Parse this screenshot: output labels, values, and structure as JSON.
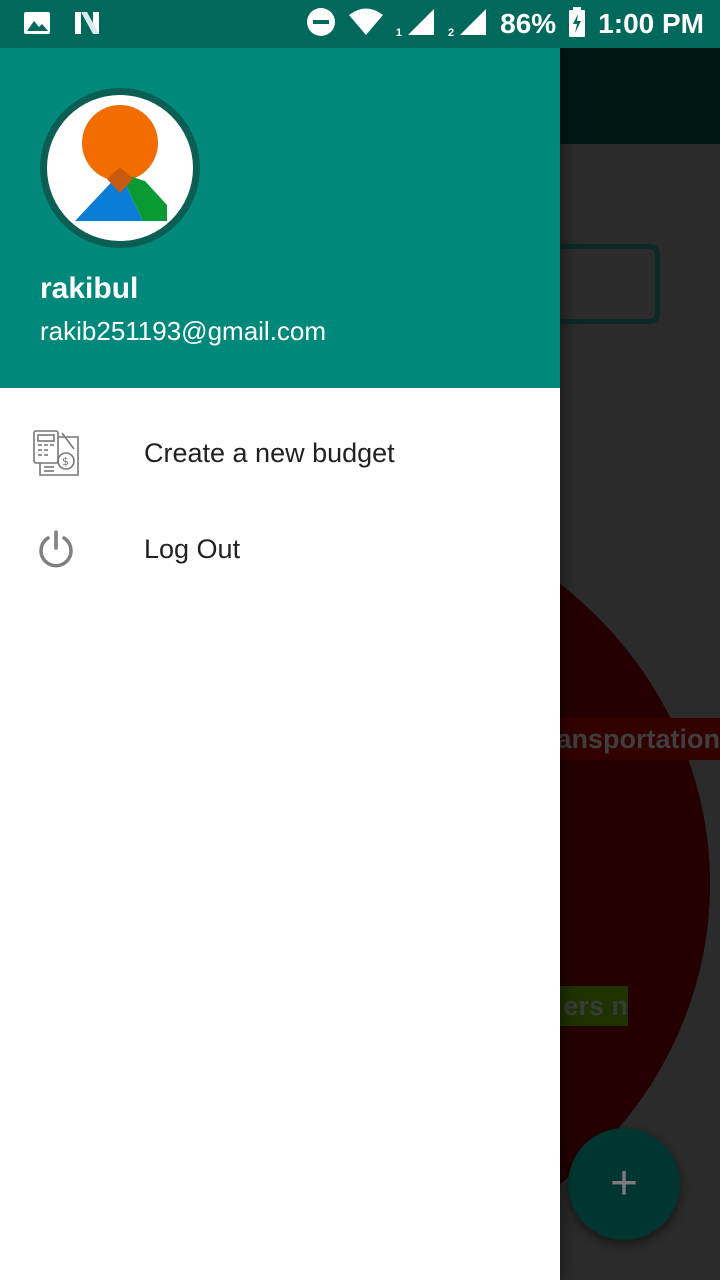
{
  "status_bar": {
    "battery_percent": "86%",
    "time": "1:00 PM",
    "sim1": "1",
    "sim2": "2",
    "icons": [
      "image-icon",
      "n-app-icon",
      "do-not-disturb-icon",
      "wifi-icon",
      "signal-icon",
      "signal-icon",
      "battery-charging-icon"
    ]
  },
  "drawer": {
    "header": {
      "name": "rakibul",
      "email": "rakib251193@gmail.com",
      "background_color": "#00897b"
    },
    "items": [
      {
        "label": "Create a new budget",
        "icon": "budget-calculator-icon"
      },
      {
        "label": "Log Out",
        "icon": "power-icon"
      }
    ]
  },
  "background_app": {
    "labels": [
      "ansportation",
      "ers n"
    ],
    "fab_label": "+"
  }
}
